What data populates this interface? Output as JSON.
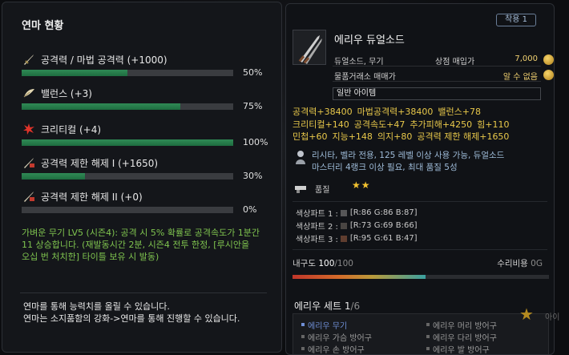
{
  "left": {
    "title": "연마 현황",
    "stats": [
      {
        "label": "공격력 / 마법 공격력 (+1000)",
        "pct_text": "50%",
        "fill": 0.5,
        "icon": "sword-icon"
      },
      {
        "label": "밸런스 (+3)",
        "pct_text": "75%",
        "fill": 0.75,
        "icon": "feather-icon"
      },
      {
        "label": "크리티컬 (+4)",
        "pct_text": "100%",
        "fill": 1.0,
        "icon": "critical-burst-icon"
      },
      {
        "label": "공격력 제한 해제 I (+1650)",
        "pct_text": "30%",
        "fill": 0.3,
        "icon": "unlock-sword-icon"
      },
      {
        "label": "공격력 제한 해제 II (+0)",
        "pct_text": "0%",
        "fill": 0.0,
        "icon": "unlock-sword-icon"
      }
    ],
    "description": [
      "가벼운 무기 LV5 (시즌4): 공격 시 5% 확률로 공격속도가 1분간",
      "11 상승합니다. (재발동시간 2분, 시즌4 전투 한정, [루시안을",
      "오십 번 처치한] 타이틀 보유 시 발동)"
    ],
    "footer": [
      "연마를 통해 능력치를 올릴 수 있습니다.",
      "연마는 소지품함의 강화->연마를 통해 진행할 수 있습니다."
    ]
  },
  "item": {
    "badge": "착용 1",
    "name": "에리우 듀얼소드",
    "type_label": "듀얼소드, 무기",
    "shop_label": "상점 매입가",
    "shop_price": "7,000",
    "trade_label": "물품거래소 매매가",
    "trade_value": "알 수 없음",
    "grade": "일반 아이템",
    "stats_lines": [
      [
        "공격력+38400",
        "마법공격력+38400",
        "밸런스+78"
      ],
      [
        "크리티컬+140",
        "공격속도+47",
        "추가피해+4250",
        "힘+110"
      ],
      [
        "민첩+60",
        "지능+148",
        "의지+80",
        "공격력 제한 해제+1650"
      ]
    ],
    "requirement": [
      "리시타, 벨라 전용, 125 레벨 이상 사용 가능, 듀얼소드",
      "마스터리 4랭크 이상 필요, 최대 품질 5성"
    ],
    "quality_label": "품질",
    "quality_stars": "★★",
    "colors": [
      {
        "label": "색상파트 1 :",
        "value": "[R:86 G:86 B:87]",
        "hex": "#565657"
      },
      {
        "label": "색상파트 2 :",
        "value": "[R:73 G:69 B:66]",
        "hex": "#494542"
      },
      {
        "label": "색상파트 3 :",
        "value": "[R:95 G:61 B:47]",
        "hex": "#5f3d2f"
      }
    ],
    "durability_label": "내구도",
    "durability_current": "100",
    "durability_max": "/100",
    "durability_fill": 1.0,
    "repair_label": "수리비용",
    "repair_value": "0G",
    "set_title": "에리우 세트",
    "set_count": "1",
    "set_total": "/6",
    "set_items": [
      {
        "label": "에리우 무기",
        "active": true
      },
      {
        "label": "에리우 머리 방어구",
        "active": false
      },
      {
        "label": "에리우 가슴 방어구",
        "active": false
      },
      {
        "label": "에리우 다리 방어구",
        "active": false
      },
      {
        "label": "에리우 손 방어구",
        "active": false
      },
      {
        "label": "에리우 발 방어구",
        "active": false
      }
    ]
  },
  "side": {
    "text": "아이"
  }
}
